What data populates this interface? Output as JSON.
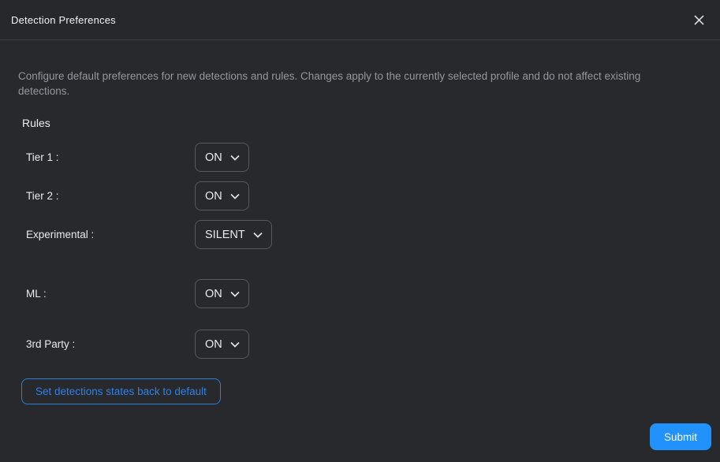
{
  "dialog": {
    "title": "Detection Preferences",
    "description": "Configure default preferences for new detections and rules. Changes apply to the currently selected profile and do not affect existing detections.",
    "section_title": "Rules",
    "rows": [
      {
        "label": "Tier 1 :",
        "value": "ON"
      },
      {
        "label": "Tier 2 :",
        "value": "ON"
      },
      {
        "label": "Experimental :",
        "value": "SILENT"
      },
      {
        "label": "ML :",
        "value": "ON"
      },
      {
        "label": "3rd Party :",
        "value": "ON"
      }
    ],
    "reset_button_label": "Set detections states back to default",
    "submit_button_label": "Submit",
    "icons": {
      "close": "close-icon",
      "dropdown": "chevron-down-icon"
    },
    "colors": {
      "accent_blue": "#2191fb",
      "outline_blue": "#2b7de0",
      "background": "#28292d",
      "header_background": "#26282b",
      "dropdown_border": "#56595d"
    }
  }
}
